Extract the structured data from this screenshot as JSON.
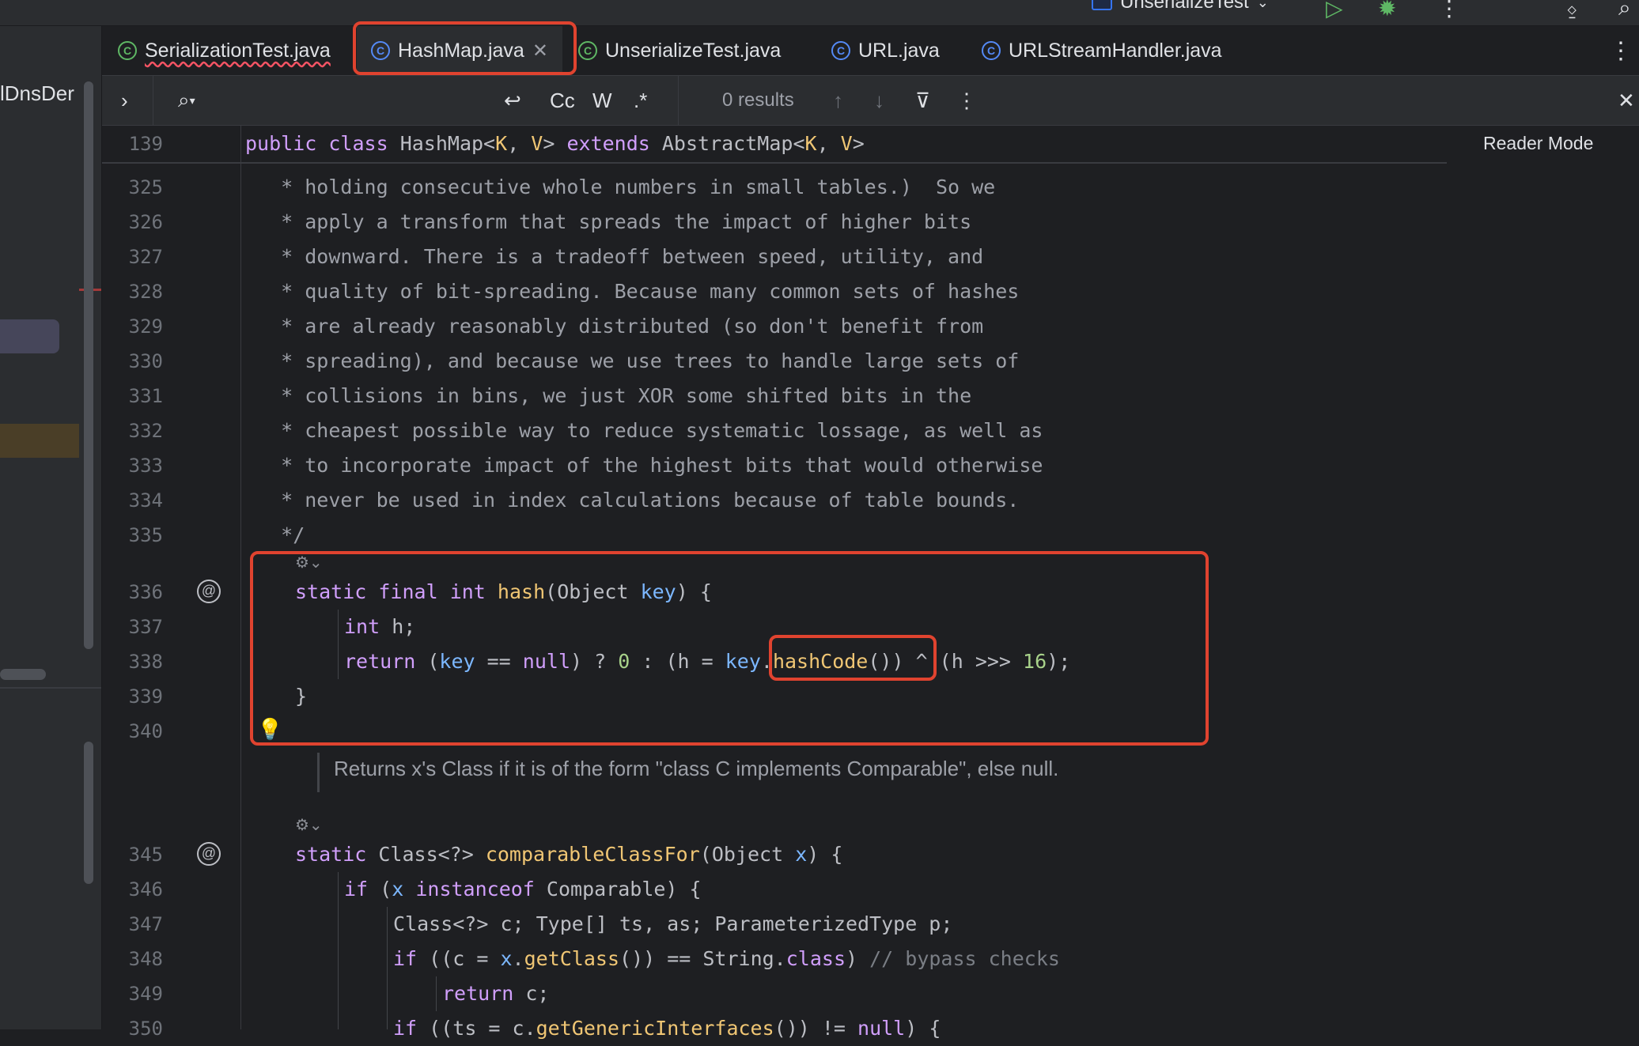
{
  "run_config": {
    "label": "UnserializeTest"
  },
  "left_panel": {
    "label": "lDnsDer"
  },
  "tabs": [
    {
      "label": "SerializationTest.java",
      "icon": "class-icon-green"
    },
    {
      "label": "HashMap.java",
      "icon": "class-icon",
      "active": true
    },
    {
      "label": "UnserializeTest.java",
      "icon": "class-icon-green"
    },
    {
      "label": "URL.java",
      "icon": "class-icon"
    },
    {
      "label": "URLStreamHandler.java",
      "icon": "class-icon"
    }
  ],
  "search": {
    "case_label": "Cc",
    "word_label": "W",
    "regex_label": ".*",
    "results": "0 results"
  },
  "sticky": {
    "line": "139",
    "code": {
      "a": "public",
      "b": "class",
      "c": "HashMap<",
      "d": "K",
      "e": ", ",
      "f": "V",
      "g": "> ",
      "h": "extends",
      "i": " AbstractMap<",
      "j": "K",
      "k": ", ",
      "l": "V",
      "m": ">"
    }
  },
  "reader_mode": "Reader Mode",
  "lines": {
    "l325": {
      "n": "325",
      "t": "   * holding consecutive whole numbers in small tables.)  So we"
    },
    "l326": {
      "n": "326",
      "t": "   * apply a transform that spreads the impact of higher bits"
    },
    "l327": {
      "n": "327",
      "t": "   * downward. There is a tradeoff between speed, utility, and"
    },
    "l328": {
      "n": "328",
      "t": "   * quality of bit-spreading. Because many common sets of hashes"
    },
    "l329": {
      "n": "329",
      "t": "   * are already reasonably distributed (so don't benefit from"
    },
    "l330": {
      "n": "330",
      "t": "   * spreading), and because we use trees to handle large sets of"
    },
    "l331": {
      "n": "331",
      "t": "   * collisions in bins, we just XOR some shifted bits in the"
    },
    "l332": {
      "n": "332",
      "t": "   * cheapest possible way to reduce systematic lossage, as well as"
    },
    "l333": {
      "n": "333",
      "t": "   * to incorporate impact of the highest bits that would otherwise"
    },
    "l334": {
      "n": "334",
      "t": "   * never be used in index calculations because of table bounds."
    },
    "l335": {
      "n": "335",
      "t": "   */"
    },
    "l336": {
      "n": "336",
      "a": "static",
      "b": "final",
      "c": "int",
      "d": "hash",
      "e": "(Object ",
      "f": "key",
      "g": ") {"
    },
    "l337": {
      "n": "337",
      "a": "int",
      "b": " h;"
    },
    "l338": {
      "n": "338",
      "a": "return",
      "b": " (",
      "c": "key",
      "d": " == ",
      "e": "null",
      "f": ") ? ",
      "g": "0",
      "h": " : (h = ",
      "i": "key",
      "j": ".",
      "k": "hashCode",
      "l": "()) ^ (h >>> ",
      "m": "16",
      "o": ");"
    },
    "l339": {
      "n": "339",
      "t": "}"
    },
    "l340": {
      "n": "340"
    },
    "doc": "Returns x's Class if it is of the form \"class C implements Comparable\", else null.",
    "l345": {
      "n": "345",
      "a": "static",
      "b": " Class<?> ",
      "c": "comparableClassFor",
      "d": "(Object ",
      "e": "x",
      "f": ") {"
    },
    "l346": {
      "n": "346",
      "a": "if",
      "b": " (",
      "c": "x",
      "d": " ",
      "e": "instanceof",
      "f": " Comparable) {"
    },
    "l347": {
      "n": "347",
      "t": "Class<?> c; Type[] ts, as; ParameterizedType p;"
    },
    "l348": {
      "n": "348",
      "a": "if",
      "b": " ((c = ",
      "c": "x",
      "d": ".",
      "e": "getClass",
      "f": "()) == String.",
      "g": "class",
      "h": ") ",
      "i": "// bypass checks"
    },
    "l349": {
      "n": "349",
      "a": "return",
      "b": " c;"
    },
    "l350": {
      "n": "350",
      "a": "if",
      "b": " ((ts = c.",
      "c": "getGenericInterfaces",
      "d": "()) != ",
      "e": "null",
      "f": ") {"
    }
  },
  "colors": {
    "accent": "#3574f0",
    "highlight_box": "#e0432f",
    "keyword": "#d19ffc",
    "function": "#f0c674"
  }
}
